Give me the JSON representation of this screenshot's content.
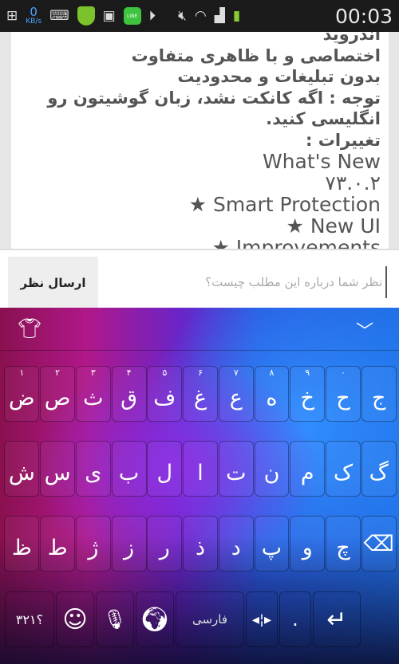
{
  "status_bar": {
    "net_speed": "0",
    "net_unit": "KB/s",
    "time": "00:03",
    "icons": [
      "add-icon",
      "keyboard-icon",
      "security-shield-icon",
      "gallery-icon",
      "line-app-icon",
      "play-icon",
      "mute-icon",
      "wifi-icon",
      "signal-icon",
      "battery-charging-icon"
    ]
  },
  "content": {
    "lines": [
      "اندروید",
      "اختصاصی و با ظاهری متفاوت",
      "بدون تبلیغات و محدودیت",
      "توجه : اگه کانکت نشد، زبان گوشیتون رو انگلیسی کنید.",
      "تغییرات :"
    ],
    "en_lines": [
      "What's New",
      "۷۳.۰.۲",
      "★ Smart Protection",
      "★ New UI",
      "★ Improvements"
    ]
  },
  "comment": {
    "send_label": "ارسال نظر",
    "placeholder": "نظر شما درباره این مطلب چیست؟",
    "value": ""
  },
  "keyboard": {
    "row1": [
      {
        "d": "۱",
        "c": "ض"
      },
      {
        "d": "۲",
        "c": "ص"
      },
      {
        "d": "۳",
        "c": "ث"
      },
      {
        "d": "۴",
        "c": "ق"
      },
      {
        "d": "۵",
        "c": "ف"
      },
      {
        "d": "۶",
        "c": "غ"
      },
      {
        "d": "۷",
        "c": "ع"
      },
      {
        "d": "۸",
        "c": "ه"
      },
      {
        "d": "۹",
        "c": "خ"
      },
      {
        "d": "۰",
        "c": "ح"
      },
      {
        "d": "",
        "c": "ج"
      }
    ],
    "row2": [
      "ش",
      "س",
      "ی",
      "ب",
      "ل",
      "ا",
      "ت",
      "ن",
      "م",
      "ک",
      "گ"
    ],
    "row3": [
      "ظ",
      "ط",
      "ژ",
      "ز",
      "ر",
      "ذ",
      "د",
      "پ",
      "و",
      "چ"
    ],
    "symbols_label": "؟۳۲۱",
    "language_label": "فارسی",
    "period_label": "."
  }
}
